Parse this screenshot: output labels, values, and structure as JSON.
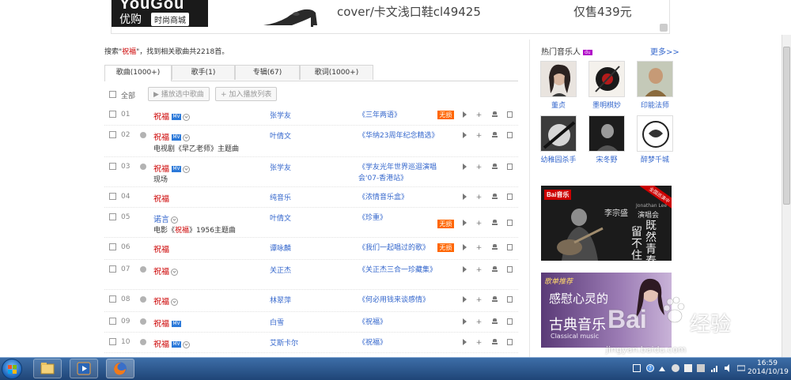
{
  "banner": {
    "logo_en": "YouGou",
    "logo_cn": "优购",
    "logo_tag": "时尚商城",
    "product_text": "cover/卡文浅口鞋cl49425",
    "price_text": "仅售439元"
  },
  "summary": {
    "prefix": "搜索\"",
    "keyword": "祝福",
    "suffix": "\"，找到相关歌曲共2218首。"
  },
  "tabs": [
    {
      "label": "歌曲(1000+)",
      "active": true
    },
    {
      "label": "歌手(1)",
      "active": false
    },
    {
      "label": "专辑(67)",
      "active": false
    },
    {
      "label": "歌词(1000+)",
      "active": false
    }
  ],
  "toolbar": {
    "select_all": "全部",
    "play_selected": "播放选中歌曲",
    "add_to_playlist": "加入播放列表"
  },
  "rows": [
    {
      "num": "01",
      "title": "祝福",
      "mv": "MV",
      "artist": "张学友",
      "album": "《三年两语》",
      "lossless": "无损"
    },
    {
      "num": "02",
      "title": "祝福",
      "mv": "MV",
      "sub": "电视剧《早乙老师》主题曲",
      "artist": "叶倩文",
      "album": "《华纳23周年纪念精选》"
    },
    {
      "num": "03",
      "title": "祝福",
      "mv": "MV",
      "sub": "现场",
      "artist": "张学友",
      "album": "《学友光年世界巡迴演唱会'07-香港站》"
    },
    {
      "num": "04",
      "title": "祝福",
      "artist": "纯音乐",
      "album": "《浓情音乐盒》"
    },
    {
      "num": "05",
      "title": "诺言",
      "sub_a": "电影《",
      "sub_b": "祝福",
      "sub_c": "》1956主题曲",
      "artist": "叶倩文",
      "album": "《珍重》",
      "lossless": "无损"
    },
    {
      "num": "06",
      "title": "祝福",
      "artist": "谭咏麟",
      "album": "《我们一起唱过的歌》",
      "lossless": "无损"
    },
    {
      "num": "07",
      "title": "祝福",
      "artist": "关正杰",
      "album": "《关正杰三合一珍藏集》"
    },
    {
      "num": "08",
      "title": "祝福",
      "artist": "林翠萍",
      "album": "《何必用钱来谈感情》"
    },
    {
      "num": "09",
      "title": "祝福",
      "mv": "MV",
      "artist": "白雪",
      "album": "《祝福》"
    },
    {
      "num": "10",
      "title": "祝福",
      "mv": "MV",
      "artist": "艾斯卡尔",
      "album": "《祝福》"
    }
  ],
  "sidebar": {
    "title": "热门音乐人",
    "badge": "du",
    "more": "更多>>",
    "artists": [
      "董贞",
      "墨明棋妙",
      "印能法师",
      "幼稚园杀手",
      "宋冬野",
      "醉梦千城"
    ],
    "ad1": {
      "brand": "Bai音乐",
      "corner": "全国巡演中",
      "name": "李宗盛",
      "name_en": "Jonathan Lee",
      "tag": "演唱会",
      "line1": "既然青春",
      "line2": "留不住"
    },
    "ad2": {
      "tag": "歌单推荐",
      "line1": "感慰心灵的",
      "line2": "古典音乐",
      "line3": "Classical music"
    }
  },
  "watermark": {
    "brand": "Bai",
    "cn": "经验",
    "url": "jingyan.baidu.com"
  },
  "taskbar": {
    "time": "16:59",
    "date": "2014/10/19"
  }
}
